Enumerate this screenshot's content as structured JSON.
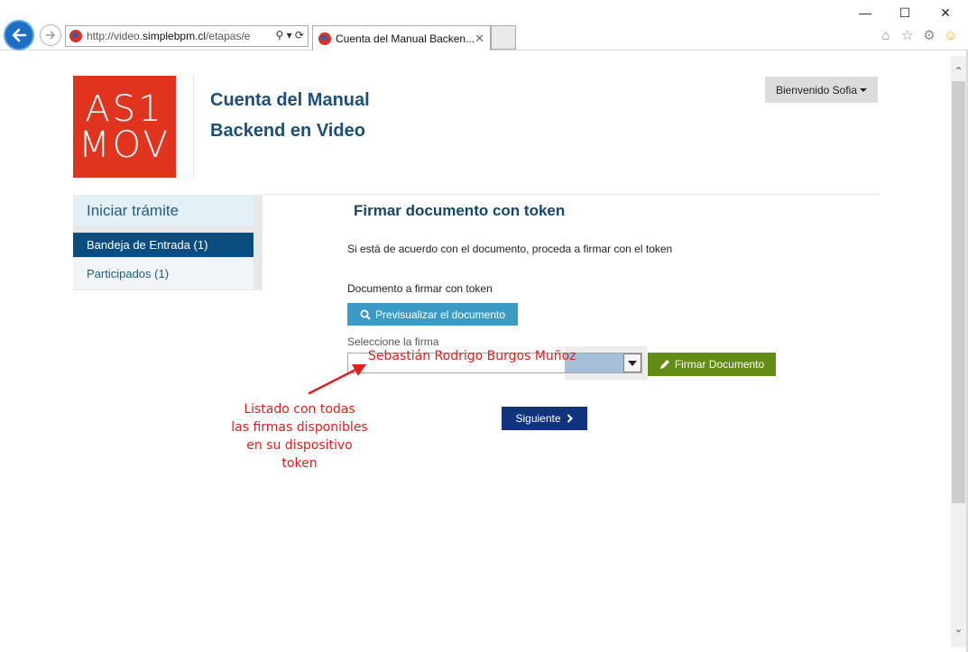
{
  "browser": {
    "address_prefix": "http://video.",
    "address_host": "simplebpm.cl",
    "address_suffix": "/etapas/e",
    "tab_title": "Cuenta del Manual Backen..."
  },
  "header": {
    "logo_line1": "AS1",
    "logo_line2": "MOV",
    "site_title": "Cuenta del Manual Backend en Video",
    "welcome_label": "Bienvenido Sofia"
  },
  "sidebar": {
    "heading": "Iniciar trámite",
    "items": [
      {
        "label": "Bandeja de Entrada (1)",
        "active": true
      },
      {
        "label": "Participados (1)",
        "active": false
      }
    ]
  },
  "main": {
    "heading": "Firmar documento con token",
    "instruction": "Si está de acuerdo con el documento, proceda a firmar con el token",
    "document_label": "Documento a firmar con token",
    "preview_button": "Previsualizar el documento",
    "select_label": "Seleccione la firma",
    "selected_signature": "Sebastián Rodrigo Burgos Muñoz",
    "sign_button": "Firmar Documento",
    "next_button": "Siguiente"
  },
  "annotation": {
    "line1": "Listado con todas",
    "line2": "las firmas disponibles",
    "line3": "en su dispositivo token"
  },
  "colors": {
    "logo": "#e0341e",
    "primary_dark": "#0c4d7f",
    "preview_button": "#3c9bc4",
    "sign_button": "#628c16",
    "next_button": "#11337e",
    "annotation": "#e01e1e"
  }
}
